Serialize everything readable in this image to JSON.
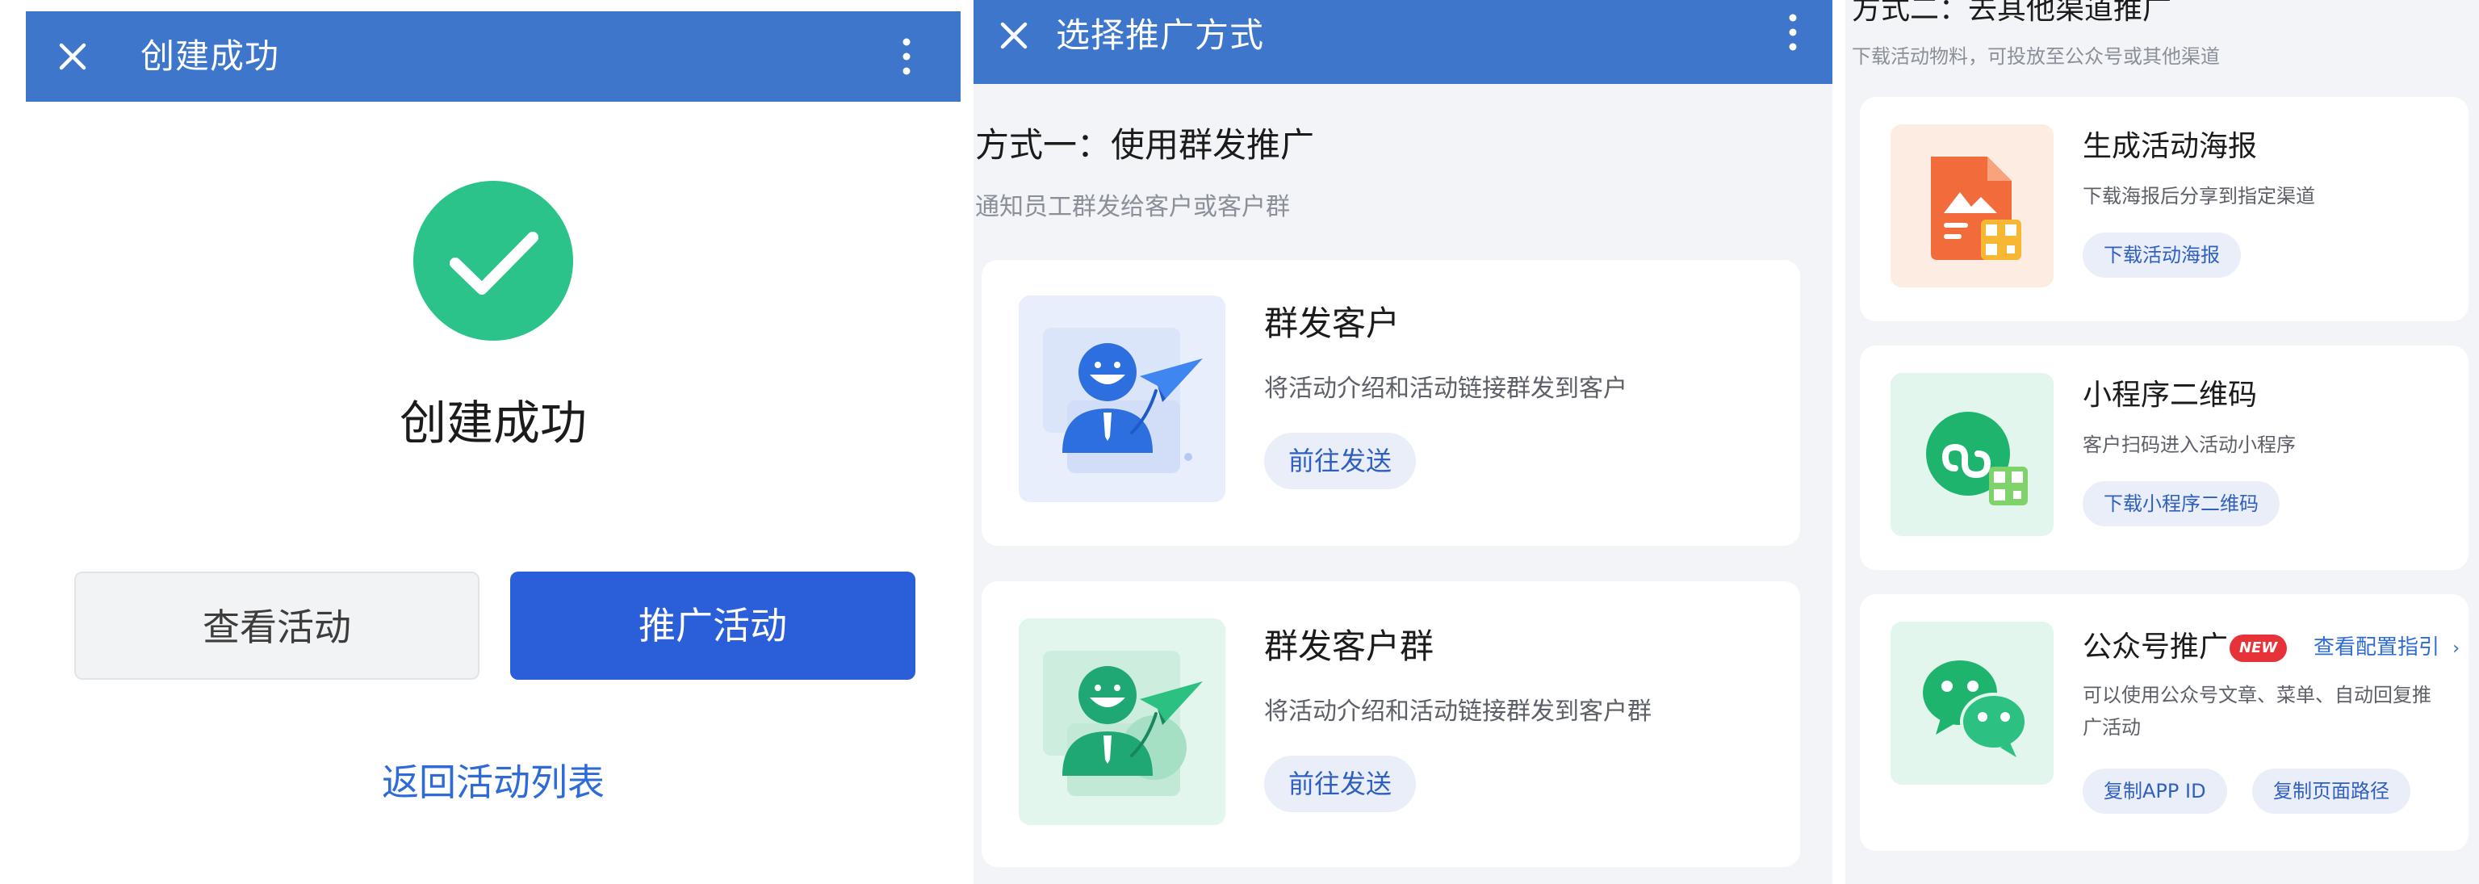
{
  "panel1": {
    "topbar": {
      "title": "创建成功"
    },
    "success_title": "创建成功",
    "view_button": "查看活动",
    "promote_button": "推广活动",
    "back_link": "返回活动列表"
  },
  "panel2": {
    "topbar": {
      "title": "选择推广方式"
    },
    "section": {
      "title": "方式一：使用群发推广",
      "subtitle": "通知员工群发给客户或客户群"
    },
    "cards": [
      {
        "title": "群发客户",
        "desc": "将活动介绍和活动链接群发到客户",
        "action": "前往发送"
      },
      {
        "title": "群发客户群",
        "desc": "将活动介绍和活动链接群发到客户群",
        "action": "前往发送"
      }
    ]
  },
  "panel3": {
    "section": {
      "title": "方式二：去其他渠道推广",
      "subtitle": "下载活动物料，可投放至公众号或其他渠道"
    },
    "cards": [
      {
        "title": "生成活动海报",
        "desc": "下载海报后分享到指定渠道",
        "action": "下载活动海报"
      },
      {
        "title": "小程序二维码",
        "desc": "客户扫码进入活动小程序",
        "action": "下载小程序二维码"
      },
      {
        "title": "公众号推广",
        "badge": "NEW",
        "guide_link": "查看配置指引",
        "desc_line1": "可以使用公众号文章、菜单、自动回复推",
        "desc_line2": "广活动",
        "action1": "复制APP ID",
        "action2": "复制页面路径"
      }
    ]
  },
  "colors": {
    "topbar": "#3e76cb",
    "success_green": "#2bc38a",
    "primary_button": "#2a5fd9",
    "link_blue": "#2f6bd6",
    "chip_bg": "#e9eef9",
    "badge_red": "#e8323a"
  }
}
